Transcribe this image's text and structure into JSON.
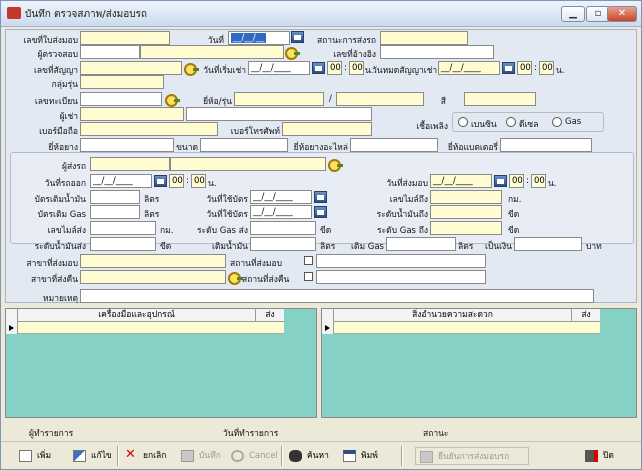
{
  "window": {
    "title": "บันทึก ตรวจสภาพ/ส่งมอบรถ"
  },
  "controls": {
    "minimize": "▁",
    "restore": "▫",
    "close": "✕"
  },
  "row1": {
    "delivery_no": "เลขที่ใบส่งมอบ",
    "date": "วันที่",
    "date_value": "__/__/__",
    "car_status": "สถานะการส่งรถ"
  },
  "row2": {
    "inspector": "ผู้ตรวจสอบ",
    "ref_no": "เลขที่อ้างอิง"
  },
  "row3": {
    "contract_no": "เลขที่สัญญา",
    "start_date": "วันที่เริ่มเช่า",
    "start_date_value": "__/__/____",
    "end_date": "วันหมดสัญญาเช่า",
    "end_date_value": "__/__/____",
    "hh": "00",
    "colon": ":",
    "mm": "00",
    "unit": "น."
  },
  "row4": {
    "group": "กลุ่มรุ่น"
  },
  "row5": {
    "reg_no": "เลขทะเบียน",
    "brand_model": "ยี่ห้อ/รุ่น",
    "slash": "/",
    "color": "สี"
  },
  "row6": {
    "renter": "ผู้เช่า",
    "fuel": "เชื้อเพลิง",
    "fuel_options": [
      "เบนซิน",
      "ดีเซล",
      "Gas"
    ]
  },
  "row7": {
    "mobile": "เบอร์มือถือ",
    "phone": "เบอร์โทรศัพท์"
  },
  "row8": {
    "tire_brand": "ยี่ห้อยาง",
    "size": "ขนาด",
    "spare_brand": "ยี่ห้อยางอะไหล่",
    "battery_brand": "ยี่ห้อแบตเตอรี่"
  },
  "delivery": {
    "driver": "ผู้ส่งรถ",
    "out_date": "วันที่รถออก",
    "out_date_value": "__/__/____",
    "deliver_date": "วันที่ส่งมอบ",
    "deliver_date_value": "__/__/____",
    "fill_oil": "บัตรเติมน้ำมัน",
    "liter": "ลิตร",
    "use_date1": "วันที่ใช้บัตร",
    "use_date1_value": "__/__/____",
    "mile_arrive": "เลขไมล์ถึง",
    "km": "กม.",
    "fill_gas": "บัตรเติม Gas",
    "use_date2": "วันที่ใช้บัตร",
    "use_date2_value": "__/__/____",
    "oil_arrive": "ระดับน้ำมันถึง",
    "notch": "ขีด",
    "mile_send": "เลขไมล์ส่ง",
    "gas_send": "ระดับ Gas ส่ง",
    "gas_arrive": "ระดับ Gas ถึง",
    "oil_send": "ระดับน้ำมันส่ง",
    "add_oil": "เติมน้ำมัน",
    "add_gas": "เติม Gas",
    "amount": "เป็นเงิน",
    "baht": "บาท"
  },
  "branch": {
    "deliver_branch": "สาขาที่ส่งมอบ",
    "deliver_place": "สถานที่ส่งมอบ",
    "return_branch": "สาขาที่ส่งคืน",
    "return_place": "สถานที่ส่งคืน"
  },
  "note": {
    "label": "หมายเหตุ"
  },
  "grid_left": {
    "col_tool": "เครื่องมือและอุปกรณ์",
    "col_send": "ส่ง"
  },
  "grid_right": {
    "col_facility": "สิ่งอำนวยความสะดวก",
    "col_send": "ส่ง"
  },
  "status": {
    "operator": "ผู้ทำรายการ",
    "op_date": "วันที่ทำรายการ",
    "state": "สถานะ"
  },
  "toolbar": {
    "add": "เพิ่ม",
    "edit": "แก้ไข",
    "cancel_doc": "ยกเลิก",
    "save": "บันทึก",
    "cancel": "Cancel",
    "search": "ค้นหา",
    "print": "พิมพ์",
    "confirm": "ยืนยันการส่งมอบรถ",
    "exit": "ปิด"
  },
  "colors": {
    "field": "#fffcd2",
    "grid": "#86d1c6",
    "selection": "#316ac5"
  }
}
